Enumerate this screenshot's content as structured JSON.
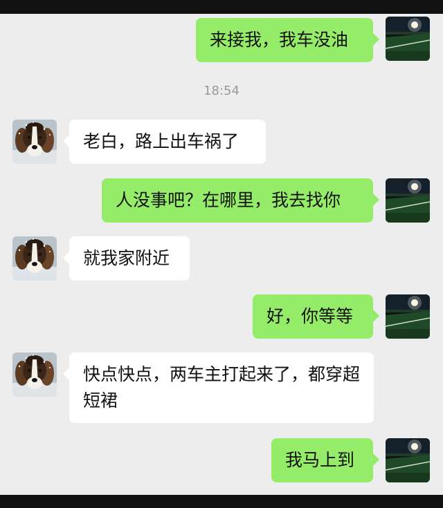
{
  "timestamp": "18:54",
  "avatars": {
    "self": "field-at-night-avatar",
    "friend": "dog-avatar"
  },
  "messages": [
    {
      "from": "self",
      "text": "来接我，我车没油"
    },
    {
      "from": "friend",
      "text": "老白，路上出车祸了"
    },
    {
      "from": "self",
      "text": "人没事吧？在哪里，我去找你"
    },
    {
      "from": "friend",
      "text": "就我家附近"
    },
    {
      "from": "self",
      "text": "好，你等等"
    },
    {
      "from": "friend",
      "text": "快点快点，两车主打起来了，都穿超短裙"
    },
    {
      "from": "self",
      "text": "我马上到"
    }
  ],
  "colors": {
    "background": "#ededed",
    "outgoing_bubble": "#95ec69",
    "incoming_bubble": "#ffffff"
  }
}
